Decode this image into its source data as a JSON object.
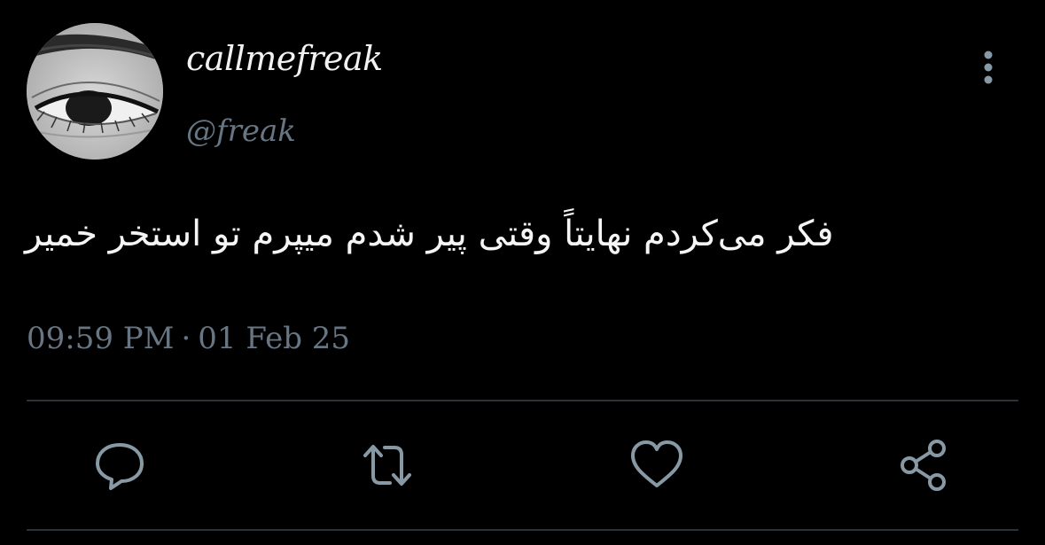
{
  "tweet": {
    "author": {
      "display_name": "callmefreak",
      "handle": "@freak"
    },
    "text": "فکر می‌کردم نهایتاً وقتی پیر شدم میپرم تو استخر خمیر",
    "timestamp": {
      "time": "09:59 PM",
      "separator": "·",
      "date": "01 Feb 25"
    }
  },
  "icons": {
    "more": "more-vertical-icon",
    "reply": "reply-icon",
    "retweet": "retweet-icon",
    "like": "heart-icon",
    "share": "share-icon"
  },
  "colors": {
    "background": "#000000",
    "primary_text": "#f5f5f5",
    "secondary_text": "#687684",
    "icon": "#8899a6",
    "divider": "#2b3238"
  }
}
